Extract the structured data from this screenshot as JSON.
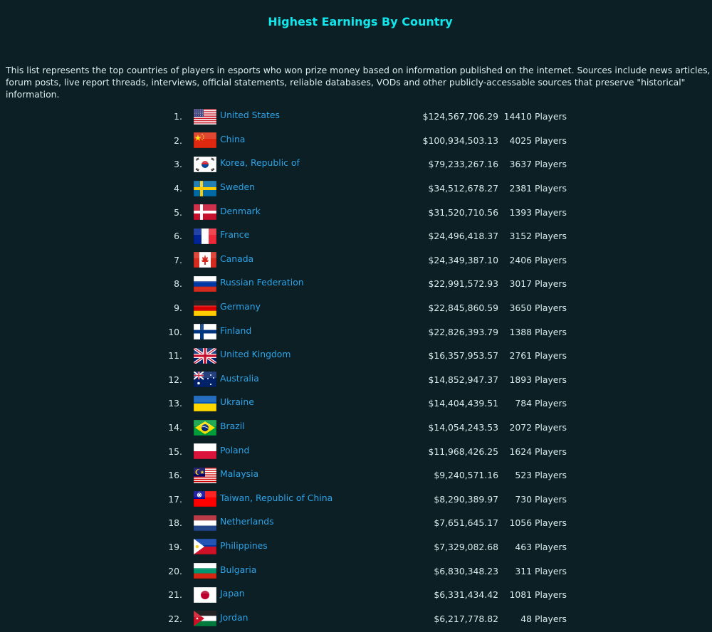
{
  "page": {
    "title": "Highest Earnings By Country",
    "intro": "This list represents the top countries of players in esports who won prize money based on information published on the internet. Sources include news articles, forum posts, live report threads, interviews, official statements, reliable databases, VODs and other publicly-accessable sources that preserve \"historical\" information."
  },
  "rows": [
    {
      "rank": "1.",
      "country": "United States",
      "earnings": "$124,567,706.29",
      "players": "14410 Players",
      "flag": "us-flag-icon"
    },
    {
      "rank": "2.",
      "country": "China",
      "earnings": "$100,934,503.13",
      "players": "4025 Players",
      "flag": "cn-flag-icon"
    },
    {
      "rank": "3.",
      "country": "Korea, Republic of",
      "earnings": "$79,233,267.16",
      "players": "3637 Players",
      "flag": "kr-flag-icon"
    },
    {
      "rank": "4.",
      "country": "Sweden",
      "earnings": "$34,512,678.27",
      "players": "2381 Players",
      "flag": "se-flag-icon"
    },
    {
      "rank": "5.",
      "country": "Denmark",
      "earnings": "$31,520,710.56",
      "players": "1393 Players",
      "flag": "dk-flag-icon"
    },
    {
      "rank": "6.",
      "country": "France",
      "earnings": "$24,496,418.37",
      "players": "3152 Players",
      "flag": "fr-flag-icon"
    },
    {
      "rank": "7.",
      "country": "Canada",
      "earnings": "$24,349,387.10",
      "players": "2406 Players",
      "flag": "ca-flag-icon"
    },
    {
      "rank": "8.",
      "country": "Russian Federation",
      "earnings": "$22,991,572.93",
      "players": "3017 Players",
      "flag": "ru-flag-icon"
    },
    {
      "rank": "9.",
      "country": "Germany",
      "earnings": "$22,845,860.59",
      "players": "3650 Players",
      "flag": "de-flag-icon"
    },
    {
      "rank": "10.",
      "country": "Finland",
      "earnings": "$22,826,393.79",
      "players": "1388 Players",
      "flag": "fi-flag-icon"
    },
    {
      "rank": "11.",
      "country": "United Kingdom",
      "earnings": "$16,357,953.57",
      "players": "2761 Players",
      "flag": "gb-flag-icon"
    },
    {
      "rank": "12.",
      "country": "Australia",
      "earnings": "$14,852,947.37",
      "players": "1893 Players",
      "flag": "au-flag-icon"
    },
    {
      "rank": "13.",
      "country": "Ukraine",
      "earnings": "$14,404,439.51",
      "players": "784 Players",
      "flag": "ua-flag-icon"
    },
    {
      "rank": "14.",
      "country": "Brazil",
      "earnings": "$14,054,243.53",
      "players": "2072 Players",
      "flag": "br-flag-icon"
    },
    {
      "rank": "15.",
      "country": "Poland",
      "earnings": "$11,968,426.25",
      "players": "1624 Players",
      "flag": "pl-flag-icon"
    },
    {
      "rank": "16.",
      "country": "Malaysia",
      "earnings": "$9,240,571.16",
      "players": "523 Players",
      "flag": "my-flag-icon"
    },
    {
      "rank": "17.",
      "country": "Taiwan, Republic of China",
      "earnings": "$8,290,389.97",
      "players": "730 Players",
      "flag": "tw-flag-icon"
    },
    {
      "rank": "18.",
      "country": "Netherlands",
      "earnings": "$7,651,645.17",
      "players": "1056 Players",
      "flag": "nl-flag-icon"
    },
    {
      "rank": "19.",
      "country": "Philippines",
      "earnings": "$7,329,082.68",
      "players": "463 Players",
      "flag": "ph-flag-icon"
    },
    {
      "rank": "20.",
      "country": "Bulgaria",
      "earnings": "$6,830,348.23",
      "players": "311 Players",
      "flag": "bg-flag-icon"
    },
    {
      "rank": "21.",
      "country": "Japan",
      "earnings": "$6,331,434.42",
      "players": "1081 Players",
      "flag": "jp-flag-icon"
    },
    {
      "rank": "22.",
      "country": "Jordan",
      "earnings": "$6,217,778.82",
      "players": "48 Players",
      "flag": "jo-flag-icon"
    }
  ],
  "colors": {
    "background": "#0c1f24",
    "title": "#10e6ec",
    "link": "#2ea3e8",
    "text": "#d7ecec"
  }
}
